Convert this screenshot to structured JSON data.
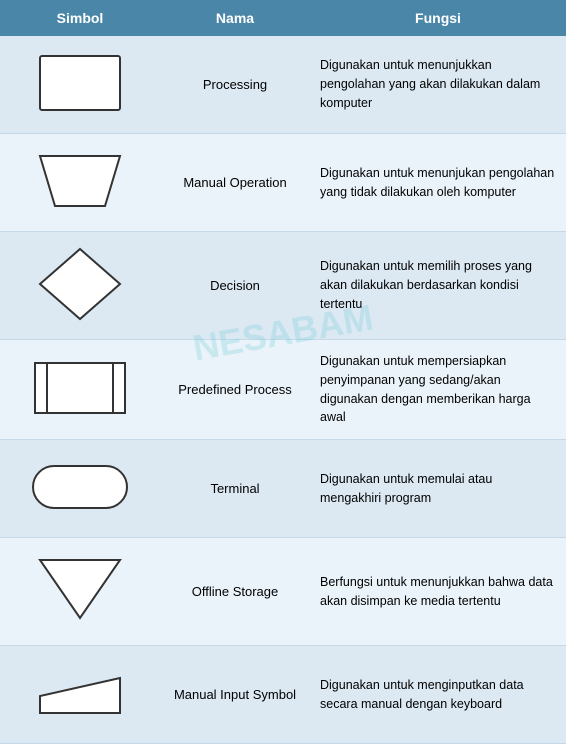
{
  "header": {
    "col1": "Simbol",
    "col2": "Nama",
    "col3": "Fungsi"
  },
  "rows": [
    {
      "name": "Processing",
      "func": "Digunakan untuk menunjukkan pengolahan yang akan dilakukan dalam komputer"
    },
    {
      "name": "Manual Operation",
      "func": "Digunakan untuk menunjukan pengolahan yang tidak dilakukan oleh komputer"
    },
    {
      "name": "Decision",
      "func": "Digunakan untuk memilih proses yang akan dilakukan berdasarkan kondisi tertentu"
    },
    {
      "name": "Predefined Process",
      "func": "Digunakan untuk mempersiapkan penyimpanan yang sedang/akan digunakan dengan memberikan harga awal"
    },
    {
      "name": "Terminal",
      "func": "Digunakan untuk memulai atau mengakhiri program"
    },
    {
      "name": "Offline Storage",
      "func": "Berfungsi untuk menunjukkan bahwa data akan disimpan ke media tertentu"
    },
    {
      "name": "Manual Input Symbol",
      "func": "Digunakan untuk menginputkan data secara manual dengan keyboard"
    }
  ]
}
